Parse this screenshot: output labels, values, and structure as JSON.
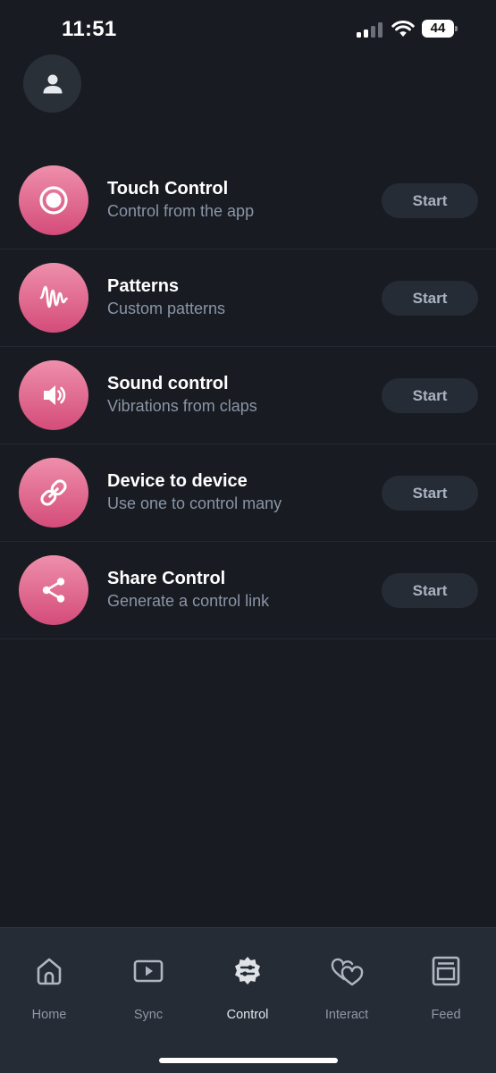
{
  "status_bar": {
    "time": "11:51",
    "battery_level": "44"
  },
  "profile": {
    "icon": "user-icon"
  },
  "controls": [
    {
      "title": "Touch Control",
      "subtitle": "Control from the app",
      "button": "Start",
      "icon": "touch-target-icon"
    },
    {
      "title": "Patterns",
      "subtitle": "Custom patterns",
      "button": "Start",
      "icon": "pattern-wave-icon"
    },
    {
      "title": "Sound control",
      "subtitle": "Vibrations from claps",
      "button": "Start",
      "icon": "speaker-icon"
    },
    {
      "title": "Device to device",
      "subtitle": "Use one to control many",
      "button": "Start",
      "icon": "link-icon"
    },
    {
      "title": "Share Control",
      "subtitle": "Generate a control link",
      "button": "Start",
      "icon": "share-icon"
    }
  ],
  "tabs": [
    {
      "label": "Home",
      "icon": "home-icon",
      "active": false
    },
    {
      "label": "Sync",
      "icon": "play-icon",
      "active": false
    },
    {
      "label": "Control",
      "icon": "control-icon",
      "active": true
    },
    {
      "label": "Interact",
      "icon": "hearts-icon",
      "active": false
    },
    {
      "label": "Feed",
      "icon": "feed-icon",
      "active": false
    }
  ],
  "colors": {
    "background": "#181b21",
    "accent_gradient_top": "#ee8fab",
    "accent_gradient_bottom": "#d44c7a",
    "button_bg": "#262c35",
    "tab_bar_bg": "#262c36"
  }
}
